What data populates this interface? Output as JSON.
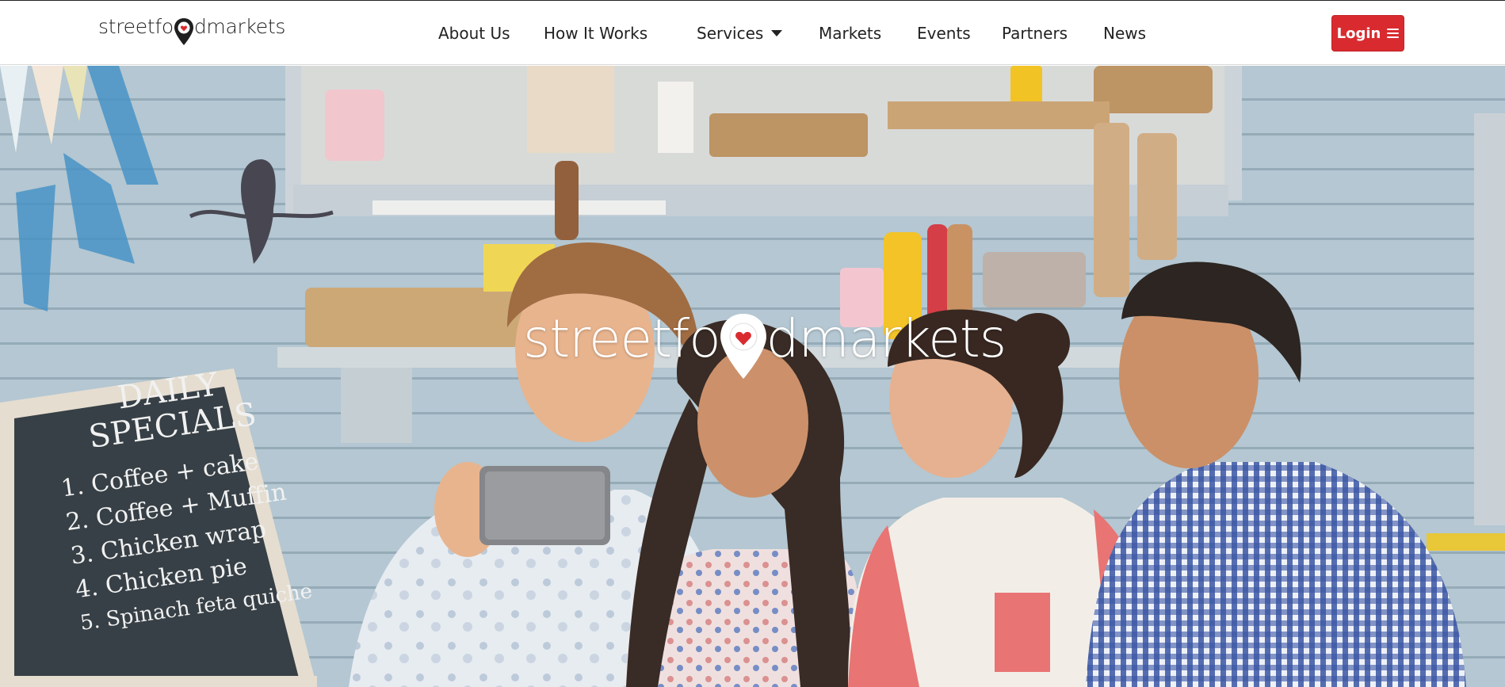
{
  "brand": {
    "name_part1": "streetfo",
    "name_part2": "dmarkets"
  },
  "nav": {
    "items": [
      {
        "label": "About Us"
      },
      {
        "label": "How It Works"
      },
      {
        "label": "Services"
      },
      {
        "label": "Markets"
      },
      {
        "label": "Events"
      },
      {
        "label": "Partners"
      },
      {
        "label": "News"
      }
    ],
    "login_label": "Login"
  },
  "hero": {
    "logo_part1": "streetfo",
    "logo_part2": "dmarkets",
    "chalkboard": {
      "heading_line1": "DAILY",
      "heading_line2": "SPECIALS",
      "items": [
        "1. Coffee + cake",
        "2. Coffee + Muffin",
        "3. Chicken wrap",
        "4. Chicken pie",
        "5. Spinach feta quiche"
      ]
    }
  },
  "colors": {
    "accent": "#d92b2f",
    "nav_text": "#222222",
    "hero_tint": "#a9c1cf"
  },
  "icons": {
    "brand_pin": "map-pin-heart-icon",
    "menu": "hamburger-icon",
    "dropdown": "caret-down-icon"
  }
}
